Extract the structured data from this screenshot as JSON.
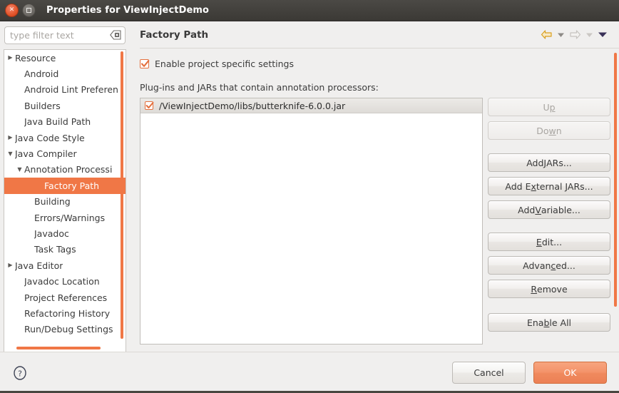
{
  "window": {
    "title": "Properties for ViewInjectDemo",
    "close_icon": "close-icon",
    "maximize_icon": "maximize-icon"
  },
  "sidebar": {
    "filter": {
      "value": "",
      "placeholder": "type filter text",
      "clear_icon": "clear-text-icon"
    },
    "items": [
      {
        "label": "Resource",
        "level": 0,
        "arrow": "collapsed",
        "selected": false
      },
      {
        "label": "Android",
        "level": 1,
        "arrow": "none",
        "selected": false
      },
      {
        "label": "Android Lint Preferen",
        "level": 1,
        "arrow": "none",
        "selected": false
      },
      {
        "label": "Builders",
        "level": 1,
        "arrow": "none",
        "selected": false
      },
      {
        "label": "Java Build Path",
        "level": 1,
        "arrow": "none",
        "selected": false
      },
      {
        "label": "Java Code Style",
        "level": 0,
        "arrow": "collapsed",
        "selected": false
      },
      {
        "label": "Java Compiler",
        "level": 0,
        "arrow": "expanded",
        "selected": false
      },
      {
        "label": "Annotation Processi",
        "level": 1,
        "arrow": "expanded",
        "selected": false
      },
      {
        "label": "Factory Path",
        "level": 3,
        "arrow": "none",
        "selected": true
      },
      {
        "label": "Building",
        "level": 2,
        "arrow": "none",
        "selected": false
      },
      {
        "label": "Errors/Warnings",
        "level": 2,
        "arrow": "none",
        "selected": false
      },
      {
        "label": "Javadoc",
        "level": 2,
        "arrow": "none",
        "selected": false
      },
      {
        "label": "Task Tags",
        "level": 2,
        "arrow": "none",
        "selected": false
      },
      {
        "label": "Java Editor",
        "level": 0,
        "arrow": "collapsed",
        "selected": false
      },
      {
        "label": "Javadoc Location",
        "level": 1,
        "arrow": "none",
        "selected": false
      },
      {
        "label": "Project References",
        "level": 1,
        "arrow": "none",
        "selected": false
      },
      {
        "label": "Refactoring History",
        "level": 1,
        "arrow": "none",
        "selected": false
      },
      {
        "label": "Run/Debug Settings",
        "level": 1,
        "arrow": "none",
        "selected": false
      }
    ]
  },
  "page": {
    "title": "Factory Path",
    "nav": {
      "back_icon": "back-arrow-icon",
      "back_menu_icon": "chevron-down-icon",
      "forward_icon": "forward-arrow-icon",
      "forward_menu_icon": "chevron-down-icon",
      "overflow_icon": "chevron-down-icon"
    },
    "enable_specific": {
      "label_before": "Enable pro",
      "label_mnemonic": "j",
      "label_after": "ect specific settings",
      "checked": true
    },
    "list_label": "Plug-ins and JARs that contain annotation processors:",
    "jars": [
      {
        "path": "/ViewInjectDemo/libs/butterknife-6.0.0.jar",
        "checked": true,
        "selected": true
      }
    ],
    "buttons": [
      {
        "before": "U",
        "mnemonic": "p",
        "after": "",
        "disabled": true,
        "gap": "none",
        "name": "up-button"
      },
      {
        "before": "Do",
        "mnemonic": "w",
        "after": "n",
        "disabled": true,
        "gap": "none",
        "name": "down-button"
      },
      {
        "before": "Add ",
        "mnemonic": "J",
        "after": "ARs...",
        "disabled": false,
        "gap": "gap",
        "name": "add-jars-button"
      },
      {
        "before": "Add E",
        "mnemonic": "x",
        "after": "ternal JARs...",
        "disabled": false,
        "gap": "none",
        "name": "add-external-jars-button"
      },
      {
        "before": "Add ",
        "mnemonic": "V",
        "after": "ariable...",
        "disabled": false,
        "gap": "none",
        "name": "add-variable-button"
      },
      {
        "before": "",
        "mnemonic": "E",
        "after": "dit...",
        "disabled": false,
        "gap": "gap",
        "name": "edit-button"
      },
      {
        "before": "Advan",
        "mnemonic": "c",
        "after": "ed...",
        "disabled": false,
        "gap": "none",
        "name": "advanced-button"
      },
      {
        "before": "",
        "mnemonic": "R",
        "after": "emove",
        "disabled": false,
        "gap": "none",
        "name": "remove-button"
      },
      {
        "before": "Ena",
        "mnemonic": "b",
        "after": "le All",
        "disabled": false,
        "gap": "gap2",
        "name": "enable-all-button"
      }
    ]
  },
  "footer": {
    "help_icon": "help-icon",
    "cancel_label": "Cancel",
    "ok_label": "OK"
  },
  "colors": {
    "accent": "#f07746",
    "selection": "#f07746",
    "primary_button": "#f08a5e",
    "titlebar": "#3b3935",
    "dialog_bg": "#f0efee"
  }
}
